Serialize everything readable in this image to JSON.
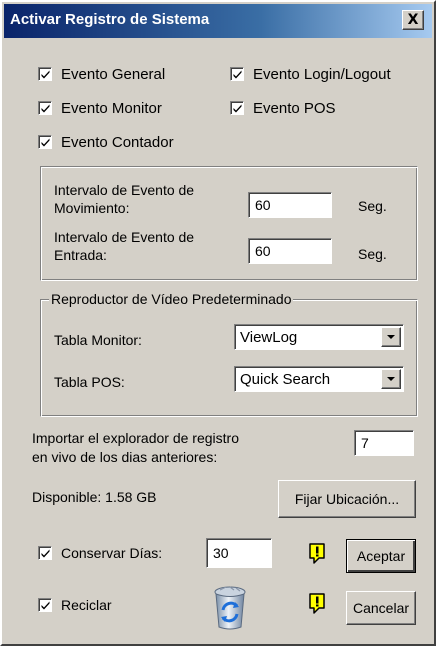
{
  "window": {
    "title": "Activar Registro de Sistema",
    "close_label": "X"
  },
  "events": [
    {
      "label": "Evento General",
      "checked": true
    },
    {
      "label": "Evento Login/Logout",
      "checked": true
    },
    {
      "label": "Evento Monitor",
      "checked": true
    },
    {
      "label": "Evento POS",
      "checked": true
    },
    {
      "label": "Evento Contador",
      "checked": true
    }
  ],
  "intervals": {
    "movement_label_line1": "Intervalo de Evento de",
    "movement_label_line2": "Movimiento:",
    "movement_value": "60",
    "movement_unit": "Seg.",
    "input_label_line1": "Intervalo de Evento de",
    "input_label_line2": "Entrada:",
    "input_value": "60",
    "input_unit": "Seg."
  },
  "player": {
    "legend": "Reproductor de Vídeo Predeterminado",
    "monitor_label": "Tabla Monitor:",
    "monitor_value": "ViewLog",
    "pos_label": "Tabla POS:",
    "pos_value": "Quick Search"
  },
  "import": {
    "label_line1": "Importar el explorador de registro",
    "label_line2": "en vivo de los dias anteriores:",
    "value": "7"
  },
  "storage": {
    "available": "Disponible: 1.58 GB",
    "set_location_label": "Fijar Ubicación..."
  },
  "keep_days": {
    "label": "Conservar Días:",
    "checked": true,
    "value": "30"
  },
  "recycle": {
    "label": "Reciclar",
    "checked": true
  },
  "buttons": {
    "accept": "Aceptar",
    "cancel": "Cancelar"
  },
  "icons": {
    "check": "check-mark-icon",
    "warning": "warning-icon",
    "recycle_bin": "recycle-bin-icon",
    "close": "close-icon"
  },
  "colors": {
    "title_bar_start": "#0a246a",
    "title_bar_end": "#a6caf0",
    "dialog_face": "#d4d0c8",
    "warning_yellow": "#ffff00"
  }
}
